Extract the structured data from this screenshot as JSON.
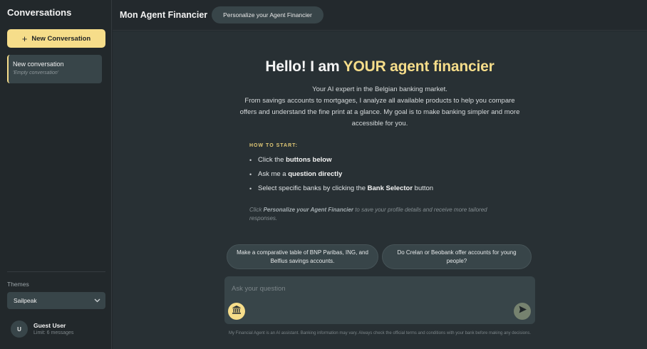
{
  "sidebar": {
    "title": "Conversations",
    "new_conversation_label": "New Conversation",
    "conversations": [
      {
        "title": "New conversation",
        "subtitle": "'Empty conversation'"
      }
    ],
    "themes_label": "Themes",
    "theme_selected": "Sailpeak",
    "user": {
      "initial": "U",
      "name": "Guest User",
      "limit": "Limit: 6 messages"
    }
  },
  "header": {
    "title": "Mon Agent Financier",
    "personalize_label": "Personalize your Agent Financier"
  },
  "main": {
    "hero_prefix": "Hello! I am ",
    "hero_highlight": "YOUR agent financier",
    "intro_line1": "Your AI expert in the Belgian banking market.",
    "intro_line2": "From savings accounts to mortgages, I analyze all available products to help you compare offers and understand the fine print at a glance. My goal is to make banking simpler and more accessible for you.",
    "how_to_start_label": "HOW TO START:",
    "steps": [
      {
        "prefix": "Click the ",
        "bold": "buttons below",
        "suffix": ""
      },
      {
        "prefix": "Ask me a ",
        "bold": "question directly",
        "suffix": ""
      },
      {
        "prefix": "Select specific banks by clicking the ",
        "bold": "Bank Selector",
        "suffix": " button"
      }
    ],
    "note_prefix": "Click ",
    "note_bold": "Personalize your Agent Financier",
    "note_suffix": " to save your profile details and receive more tailored responses.",
    "suggestions": [
      "Make a comparative table of BNP Paribas, ING, and Belfius savings accounts.",
      "Do Crelan or Beobank offer accounts for young people?"
    ],
    "input_placeholder": "Ask your question",
    "disclaimer": "My Financial Agent is an AI assistant. Banking information may vary. Always check the official terms and conditions with your bank before making any decisions."
  },
  "colors": {
    "accent": "#f6dd8a",
    "sidebar_bg": "#22282b",
    "main_bg": "#283034",
    "card_bg": "#384549",
    "send_button": "#76826f"
  },
  "icons": {
    "new_conversation": "plus-icon",
    "theme_select": "chevron-down-icon",
    "bank_selector": "bank-icon",
    "send": "send-icon"
  }
}
